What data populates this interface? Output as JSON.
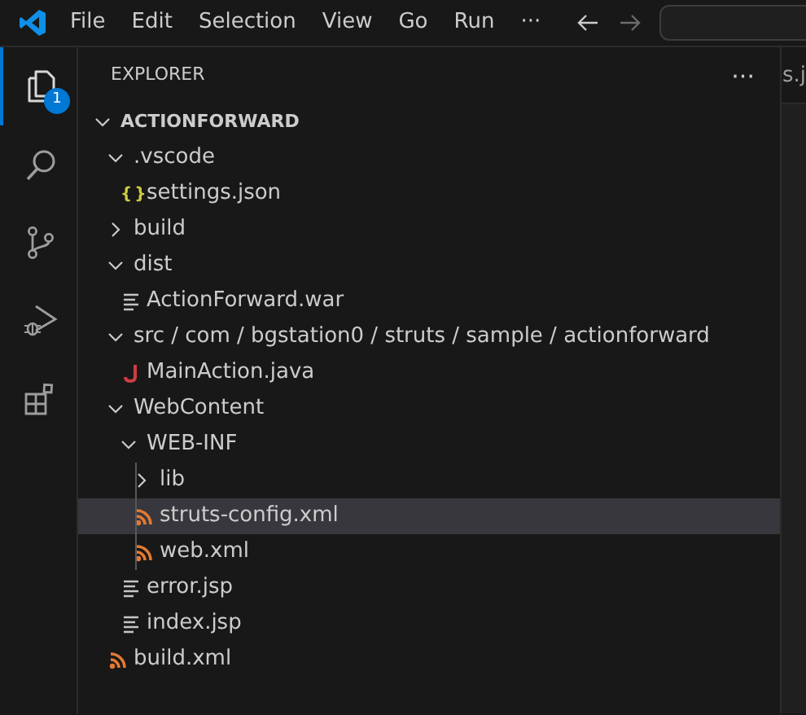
{
  "menu": [
    "File",
    "Edit",
    "Selection",
    "View",
    "Go",
    "Run",
    "···"
  ],
  "activity_bar": {
    "items": [
      {
        "selected": true,
        "badge": "1"
      },
      {
        "selected": false
      },
      {
        "selected": false
      },
      {
        "selected": false
      },
      {
        "selected": false
      }
    ]
  },
  "explorer": {
    "title": "EXPLORER",
    "more": "···",
    "root": {
      "label": "ACTIONFORWARD",
      "expanded": true
    },
    "tree": [
      {
        "kind": "folder",
        "label": ".vscode",
        "expanded": true,
        "children": [
          {
            "kind": "json-file",
            "glyph": "{ }",
            "label": "settings.json",
            "selected": false
          }
        ]
      },
      {
        "kind": "folder",
        "label": "build",
        "expanded": false
      },
      {
        "kind": "folder",
        "label": "dist",
        "expanded": true,
        "children": [
          {
            "kind": "text-file",
            "label": "ActionForward.war",
            "selected": false
          }
        ]
      },
      {
        "kind": "folder",
        "label": "src / com / bgstation0 / struts / sample / actionforward",
        "expanded": true,
        "children": [
          {
            "kind": "java-file",
            "label": "MainAction.java",
            "selected": false
          }
        ]
      },
      {
        "kind": "folder",
        "label": "WebContent",
        "expanded": true,
        "children": [
          {
            "kind": "folder",
            "label": "WEB-INF",
            "expanded": true,
            "children": [
              {
                "kind": "folder",
                "label": "lib",
                "expanded": false
              },
              {
                "kind": "xml-file",
                "label": "struts-config.xml",
                "selected": true
              },
              {
                "kind": "xml-file",
                "label": "web.xml",
                "selected": false
              }
            ]
          },
          {
            "kind": "text-file",
            "label": "error.jsp",
            "selected": false
          },
          {
            "kind": "text-file",
            "label": "index.jsp",
            "selected": false
          }
        ]
      },
      {
        "kind": "xml-file",
        "label": "build.xml",
        "selected": false
      }
    ]
  },
  "editor": {
    "tab": "s.j"
  }
}
